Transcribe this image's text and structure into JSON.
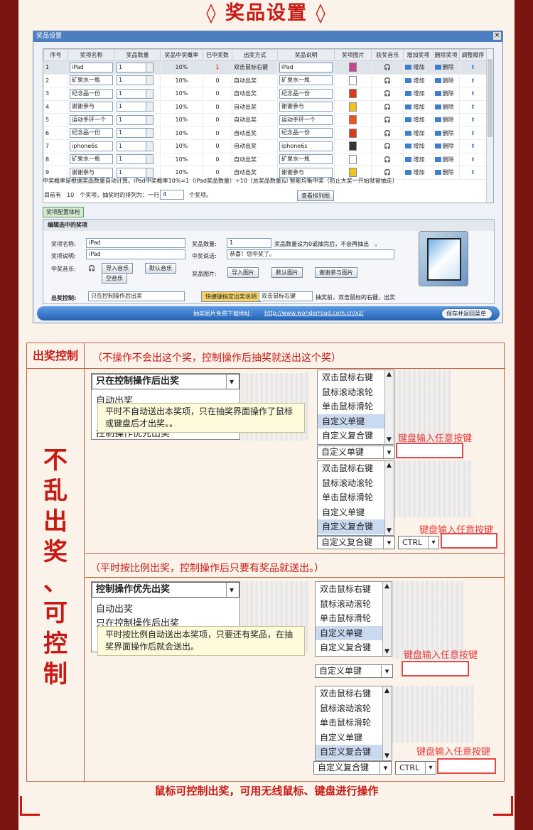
{
  "banner_title": "◊ 奖品设置 ◊",
  "window": {
    "title": "奖品设置",
    "close": "×"
  },
  "grid": {
    "headers": [
      "序号",
      "奖项名称",
      "奖品数量",
      "奖品中奖概率",
      "已中奖数",
      "出奖方式",
      "奖品说明",
      "奖项图片",
      "获奖音乐",
      "增加奖项",
      "删除奖项",
      "调整顺序"
    ],
    "rows": [
      {
        "no": "1",
        "name": "iPad",
        "qty": "1",
        "rate": "10%",
        "won": "1",
        "mode": "双击鼠标右键",
        "desc": "iPad",
        "img": "#c6468c"
      },
      {
        "no": "2",
        "name": "矿泉水一瓶",
        "qty": "1",
        "rate": "10%",
        "won": "0",
        "mode": "自动出奖",
        "desc": "矿泉水一瓶",
        "img": "#ffffff"
      },
      {
        "no": "3",
        "name": "纪念品一份",
        "qty": "1",
        "rate": "10%",
        "won": "0",
        "mode": "自动出奖",
        "desc": "纪念品一份",
        "img": "#d93a1a"
      },
      {
        "no": "4",
        "name": "谢谢参与",
        "qty": "1",
        "rate": "10%",
        "won": "0",
        "mode": "自动出奖",
        "desc": "谢谢参与",
        "img": "#f2c21c"
      },
      {
        "no": "5",
        "name": "运动手环一个",
        "qty": "1",
        "rate": "10%",
        "won": "0",
        "mode": "自动出奖",
        "desc": "运动手环一个",
        "img": "#e8541c"
      },
      {
        "no": "6",
        "name": "纪念品一份",
        "qty": "1",
        "rate": "10%",
        "won": "0",
        "mode": "自动出奖",
        "desc": "纪念品一份",
        "img": "#d93a1a"
      },
      {
        "no": "7",
        "name": "iphone6s",
        "qty": "1",
        "rate": "10%",
        "won": "0",
        "mode": "自动出奖",
        "desc": "iphone6s",
        "img": "#333333"
      },
      {
        "no": "8",
        "name": "矿泉水一瓶",
        "qty": "1",
        "rate": "10%",
        "won": "0",
        "mode": "自动出奖",
        "desc": "矿泉水一瓶",
        "img": "#ffffff"
      },
      {
        "no": "9",
        "name": "谢谢参与",
        "qty": "1",
        "rate": "10%",
        "won": "0",
        "mode": "自动出奖",
        "desc": "谢谢参与",
        "img": "#f2c21c"
      }
    ],
    "add_label": "增加",
    "del_label": "删除"
  },
  "note1": "中奖概率是根据奖品数量自动计算。iPad中奖概率10%=1（iPad奖品数量）÷10（总奖品数量）。",
  "smart_check": "☑ 智能均衡中奖（防止大奖一开始就被抽走）",
  "count_line": "目前有　10　个奖项，抽奖时的排列为：一行",
  "per_row": "4",
  "count_tail": "个奖项。",
  "view_btn": "查看排列图",
  "config_btn": "奖项配置体检",
  "edit": {
    "header": "编辑选中的奖项",
    "name_label": "奖项名称:",
    "name_val": "iPad",
    "desc_label": "奖项说明:",
    "desc_val": "iPad",
    "music_label": "中奖音乐:",
    "import_music": "导入音乐",
    "default_music": "默认音乐",
    "empty_music": "空音乐",
    "qty_label": "奖品数量:",
    "qty_val": "1",
    "qty_note": "奖品数量设为0或抽完后，不会再抽出　。",
    "say_label": "中奖说话:",
    "say_val": "恭喜！您中奖了。",
    "img_label": "奖品图片:",
    "import_img": "导入图片",
    "default_img": "默认图片",
    "thanks_img": "谢谢参与图片",
    "ctrl_label": "出奖控制:",
    "ctrl_val": "只在控制操作后出奖",
    "hotkey_btn": "快捷键指定出奖说明",
    "hotkey_val": "双击鼠标右键",
    "hotkey_note": "抽奖前，双击鼠标的右键，出奖"
  },
  "footer": {
    "tip": "抽奖图片免费下载地址:",
    "url": "http://www.wonderroad.com.cn/xz/",
    "save": "保存并返回菜单"
  },
  "section": {
    "label": "出奖控制",
    "desc1": "（不操作不会出这个奖，控制操作后抽奖就送出这个奖）",
    "desc2": "（平时按比例出奖，控制操作后只要有奖品就送出。）",
    "side": "不乱出奖、可控制"
  },
  "dd1": {
    "head": "只在控制操作后出奖",
    "opt1": "自动出奖",
    "opt3": "控制操作优先出奖",
    "tip": "平时不自动送出本奖项，只在抽奖界面操作了鼠标或键盘后才出奖。。"
  },
  "dd2": {
    "head": "控制操作优先出奖",
    "opt1": "自动出奖",
    "opt2": "只在控制操作后出奖",
    "tip": "平时按比例自动送出本奖项，只要还有奖品，在抽奖界面操作后就会送出。"
  },
  "keylist": [
    "双击鼠标右键",
    "鼠标滚动滚轮",
    "单击鼠标滑轮",
    "自定义单键",
    "自定义复合键"
  ],
  "sel_single": "自定义单键",
  "sel_combo": "自定义复合键",
  "ctrl_key": "CTRL",
  "key_hint": "键盘输入任意按键",
  "bottom": "鼠标可控制出奖，可用无线鼠标、键盘进行操作"
}
